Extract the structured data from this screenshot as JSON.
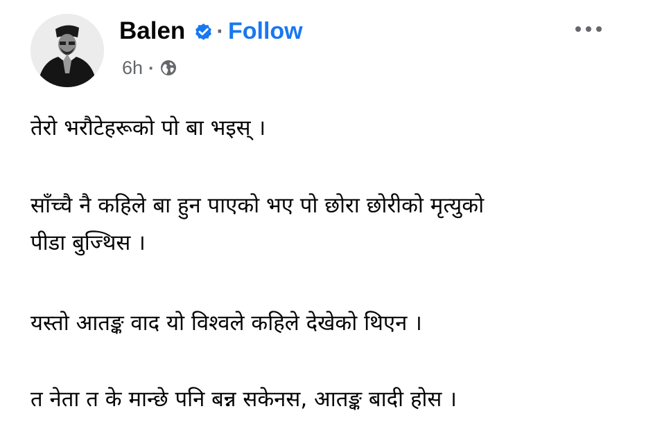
{
  "post": {
    "author": {
      "name": "Balen",
      "verified": true,
      "follow_label": "Follow",
      "separator": "·"
    },
    "meta": {
      "timestamp": "6h",
      "separator": "·",
      "audience_icon": "globe-icon"
    },
    "more_icon": "more-options-icon",
    "paragraphs": [
      {
        "lines": [
          "तेरो भरौटेहरूको पो बा भइस् ।"
        ]
      },
      {
        "lines": [
          "साँच्चै नै कहिले बा हुन पाएको  भए पो छोरा छोरीको मृत्युको",
          "पीडा बुज्थिस ।"
        ]
      },
      {
        "lines": [
          "यस्तो आतङ्क वाद यो विश्वले कहिले देखेको थिएन ।"
        ]
      },
      {
        "lines": [
          "त नेता त के मान्छे पनि बन्न सकेनस, आतङ्क बादी होस ।"
        ]
      }
    ],
    "colors": {
      "follow": "#1877f2",
      "verified_badge": "#1877f2",
      "secondary_text": "#65676b",
      "primary_text": "#050505"
    }
  }
}
